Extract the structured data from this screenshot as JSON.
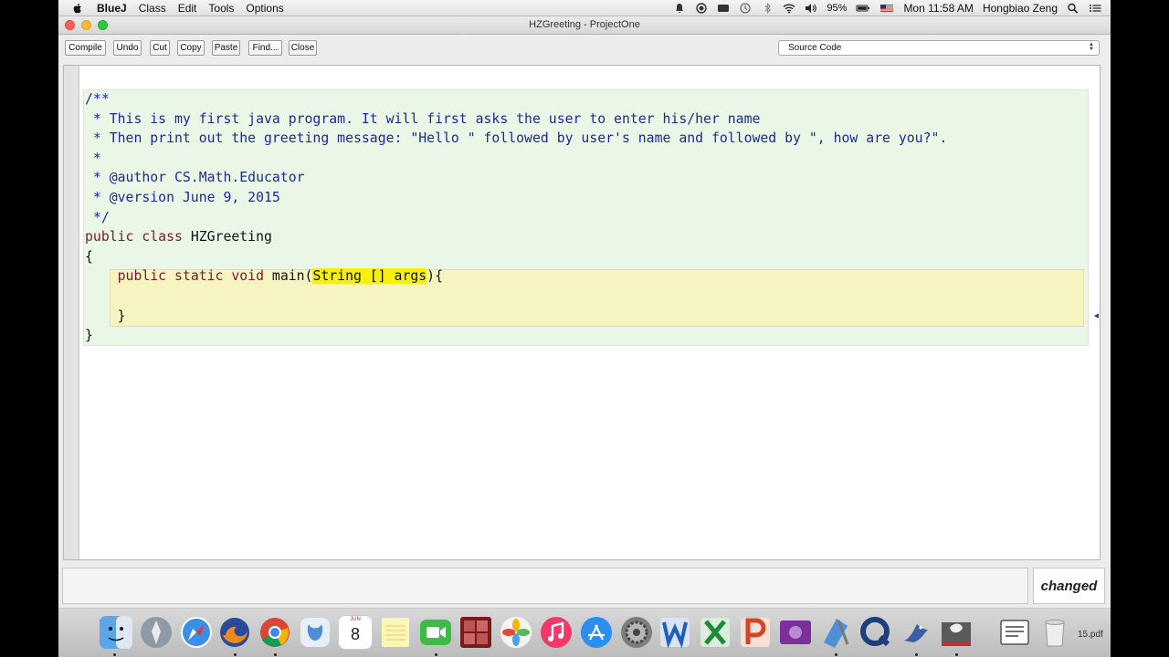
{
  "menubar": {
    "app_name": "BlueJ",
    "items": [
      "Class",
      "Edit",
      "Tools",
      "Options"
    ],
    "battery": "95%",
    "clock": "Mon 11:58 AM",
    "user": "Hongbiao Zeng"
  },
  "window": {
    "title": "HZGreeting - ProjectOne"
  },
  "toolbar": {
    "compile": "Compile",
    "undo": "Undo",
    "cut": "Cut",
    "copy": "Copy",
    "paste": "Paste",
    "find": "Find...",
    "close": "Close",
    "view_select": "Source Code"
  },
  "editor": {
    "lines": {
      "l1": "/**",
      "l2": " * This is my first java program. It will first asks the user to enter his/her name",
      "l3": " * Then print out the greeting message: \"Hello \" followed by user's name and followed by \", how are you?\".",
      "l4": " *",
      "l5": " * @author CS.Math.Educator",
      "l6": " * @version June 9, 2015",
      "l7": " */",
      "l8_kw": "public class",
      "l8_name": " HZGreeting",
      "l9": "{",
      "l10_indent": "    ",
      "l10_kw": "public static void",
      "l10_sig": " main(",
      "l10_param": "String [] args",
      "l10_end": "){",
      "l11": "",
      "l12": "    }",
      "l13": "}"
    }
  },
  "status": {
    "changed_label": "changed"
  },
  "dock": {
    "calendar_month": "JUN",
    "calendar_day": "8",
    "pdf_partial_label": "15.pdf",
    "items": [
      "finder-icon",
      "launchpad-icon",
      "safari-icon",
      "firefox-icon",
      "chrome-icon",
      "bluej-icon",
      "calendar-icon",
      "notes-icon",
      "facetime-icon",
      "photo-booth-icon",
      "photos-icon",
      "itunes-icon",
      "app-store-icon",
      "system-preferences-icon",
      "word-icon",
      "excel-icon",
      "powerpoint-icon",
      "divx-icon",
      "xcode-icon",
      "quicktime-icon",
      "bluej-bird-icon",
      "greenfoot-icon",
      "document-icon",
      "trash-icon"
    ]
  }
}
